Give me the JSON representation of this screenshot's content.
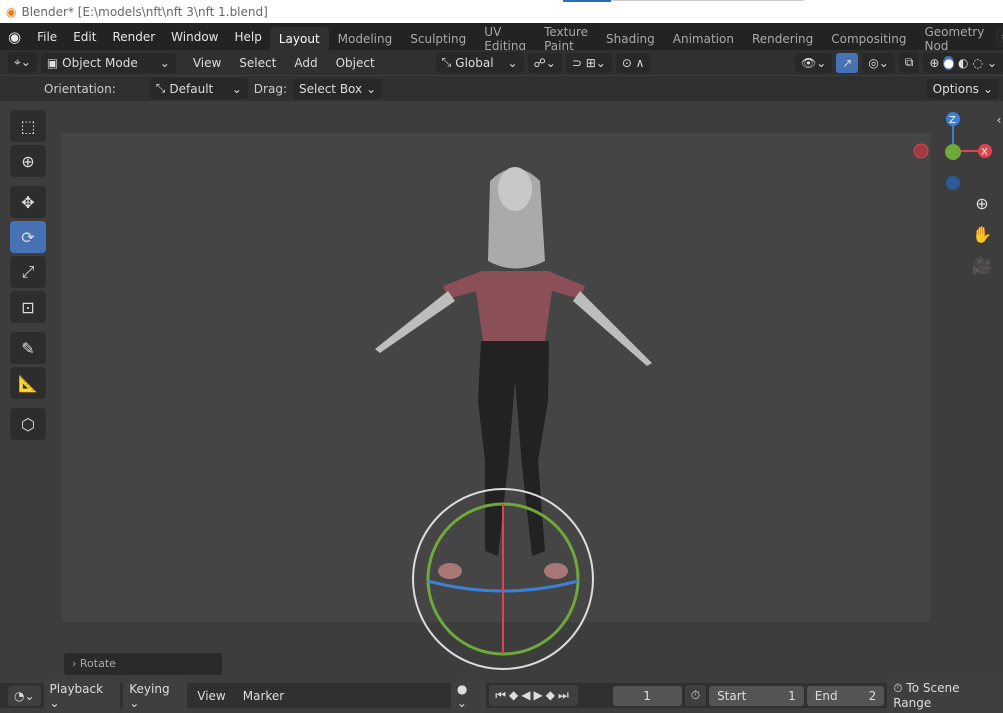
{
  "window": {
    "title": "Blender* [E:\\models\\nft\\nft 3\\nft 1.blend]"
  },
  "menu": [
    "File",
    "Edit",
    "Render",
    "Window",
    "Help"
  ],
  "workspaces": [
    "Layout",
    "Modeling",
    "Sculpting",
    "UV Editing",
    "Texture Paint",
    "Shading",
    "Animation",
    "Rendering",
    "Compositing",
    "Geometry Nod"
  ],
  "header": {
    "mode": "Object Mode",
    "menus": [
      "View",
      "Select",
      "Add",
      "Object"
    ],
    "transform": "Global"
  },
  "tool_settings": {
    "orientation_label": "Orientation:",
    "orientation": "Default",
    "drag_label": "Drag:",
    "drag": "Select Box",
    "options": "Options"
  },
  "gizmo": {
    "z": "Z",
    "x": "X"
  },
  "operator_panel": "Rotate",
  "timeline": {
    "menus": [
      "Playback",
      "Keying",
      "View",
      "Marker"
    ],
    "frame": "1",
    "start_label": "Start",
    "start": "1",
    "end_label": "End",
    "end": "2",
    "scene_range": "To Scene Range"
  },
  "colors": {
    "accent": "#4772b3",
    "x_axis": "#e0434f",
    "y_axis": "#6ea93a",
    "z_axis": "#3c7fd6"
  }
}
